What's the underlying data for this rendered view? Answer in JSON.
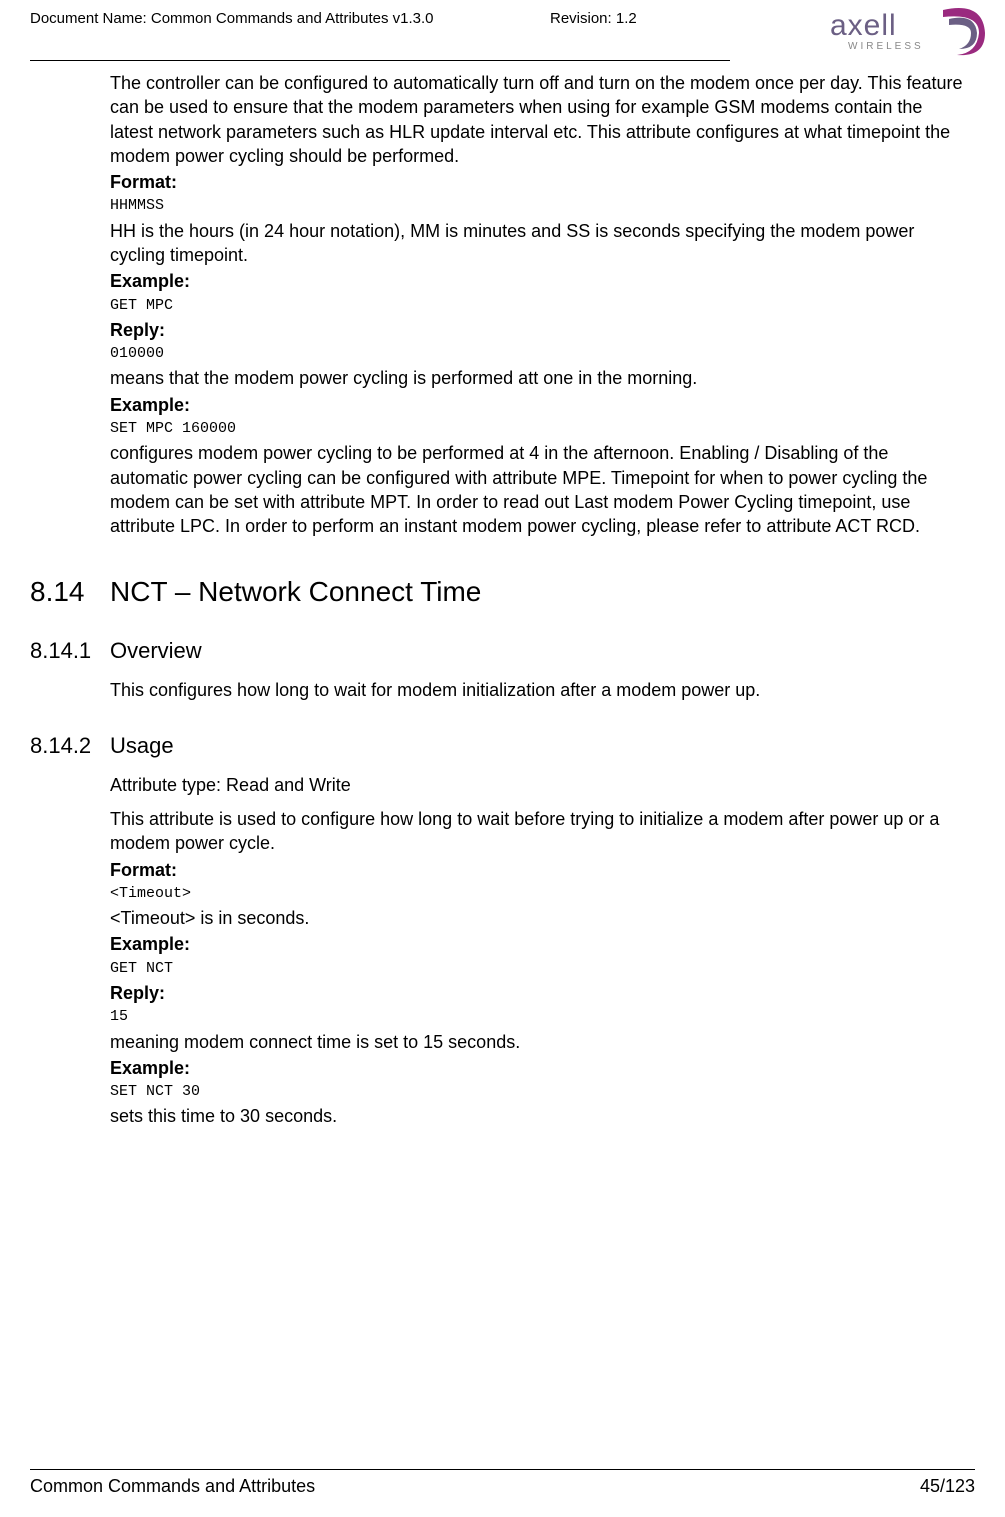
{
  "header": {
    "doc_name_label": "Document Name: Common Commands and Attributes v1.3.0",
    "revision_label": "Revision: 1.2",
    "logo_text": "axell",
    "logo_sub": "WIRELESS"
  },
  "body": {
    "intro_para": "The controller can be configured to automatically turn off and turn on the modem once per day. This feature can be used to ensure that the modem parameters when using for example GSM modems contain the latest network parameters such as HLR update interval etc. This attribute configures at what timepoint the modem power cycling should be performed.",
    "format_label": "Format:",
    "format_value": "HHMMSS",
    "format_expl": "HH is the hours (in 24 hour notation), MM is minutes and SS is seconds specifying the modem power cycling timepoint.",
    "example_label": "Example:",
    "example1_cmd": "GET MPC",
    "reply_label": "Reply:",
    "reply1_value": "010000",
    "reply1_expl": "means that the modem power cycling is performed att one in the morning.",
    "example2_cmd": "SET MPC 160000",
    "example2_expl": "configures modem power cycling to be performed at 4 in the afternoon. Enabling / Disabling of the automatic power cycling can be configured with attribute MPE. Timepoint for when to power cycling the modem can be set with attribute MPT. In order to read out Last modem Power Cycling timepoint, use attribute LPC. In order to perform an instant modem power cycling, please refer to attribute ACT RCD."
  },
  "section_8_14": {
    "num": "8.14",
    "title": "NCT – Network Connect Time"
  },
  "section_8_14_1": {
    "num": "8.14.1",
    "title": "Overview",
    "text": "This configures how long to wait for modem initialization after a modem power up."
  },
  "section_8_14_2": {
    "num": "8.14.2",
    "title": "Usage",
    "attr_type": "Attribute type: Read and Write",
    "desc": "This attribute is used to configure how long to wait before trying to initialize a modem after power up or a modem power cycle.",
    "format_label": "Format:",
    "format_value": "<Timeout>",
    "format_expl": "<Timeout> is in seconds.",
    "example_label": "Example:",
    "example1_cmd": "GET NCT",
    "reply_label": "Reply:",
    "reply1_value": "15",
    "reply1_expl": "meaning modem connect time is set to 15 seconds.",
    "example2_cmd": "SET NCT 30",
    "example2_expl": "sets this time to 30 seconds."
  },
  "footer": {
    "left": "Common Commands and Attributes",
    "right": "45/123"
  }
}
